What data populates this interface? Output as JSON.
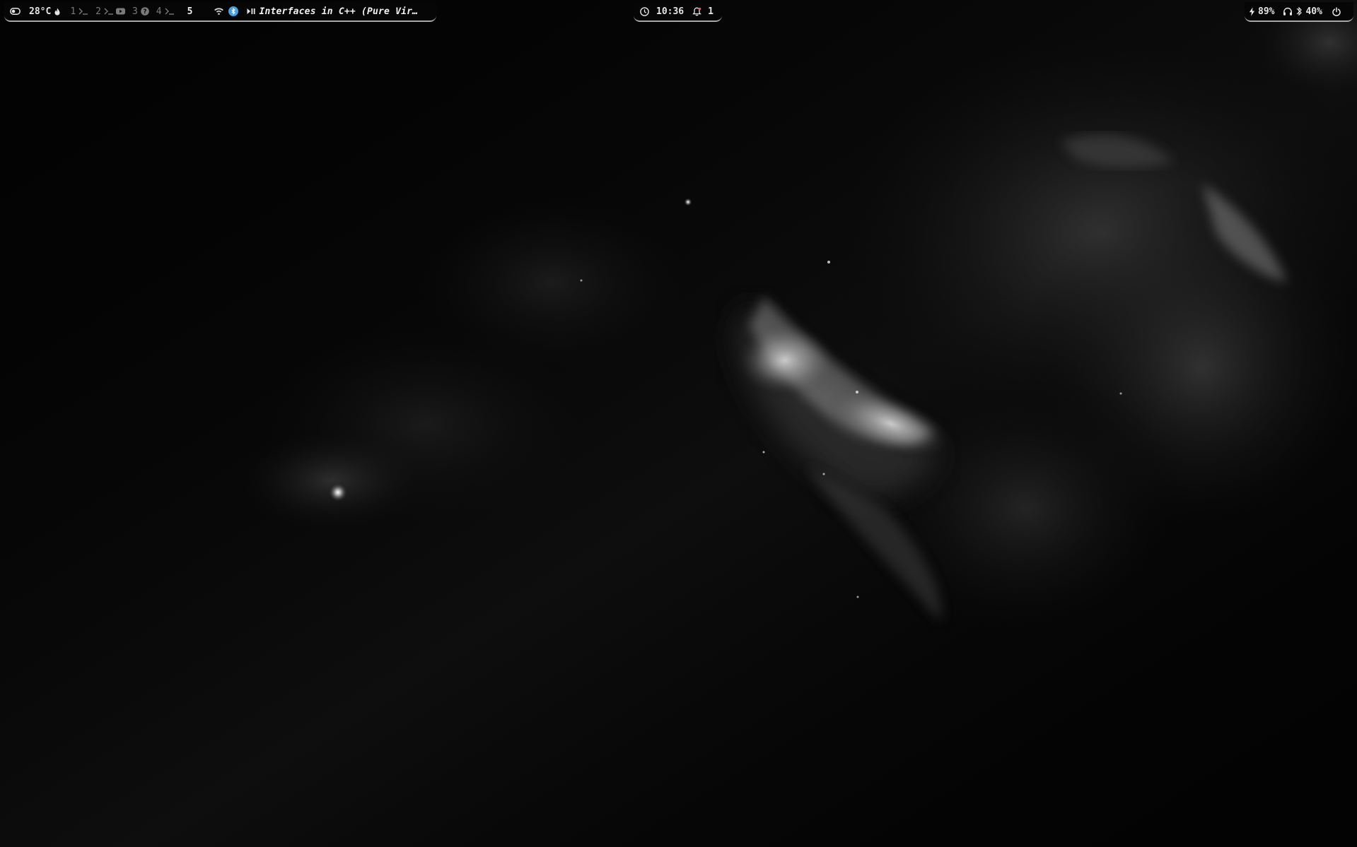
{
  "topbar": {
    "left": {
      "temperature": "28°C",
      "workspaces": [
        {
          "number": "1",
          "icon": "terminal-icon"
        },
        {
          "number": "2",
          "icon": "terminal-icon"
        },
        {
          "number": "3",
          "icon": "youtube-icon"
        },
        {
          "number": "4",
          "icon": "terminal-icon"
        },
        {
          "number": "5",
          "icon": ""
        }
      ],
      "window_title": "Interfaces in C++ (Pure Vir…"
    },
    "center": {
      "clock": "10:36",
      "notification_count": "1"
    },
    "right": {
      "battery": "89%",
      "volume": "40%"
    }
  },
  "colors": {
    "bar_background": "#060606",
    "bar_border": "#a8a8a8",
    "text": "#e6e6e6",
    "inactive_workspace": "#7a7a7a",
    "tray_badge": "#4a9fe0"
  }
}
